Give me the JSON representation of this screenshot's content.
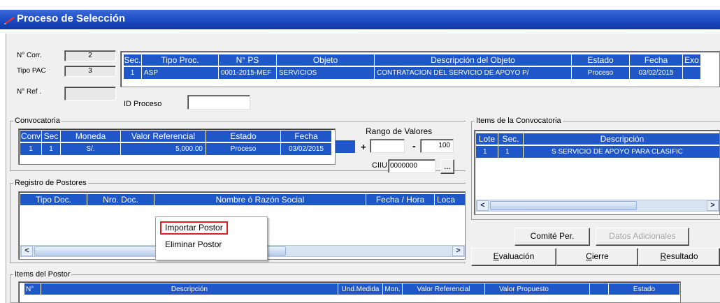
{
  "window": {
    "title": "Proceso de Selección"
  },
  "top": {
    "n_corr_label": "N° Corr.",
    "n_corr_value": "2",
    "tipo_pac_label": "Tipo PAC",
    "tipo_pac_value": "3",
    "n_ref_label": "N° Ref .",
    "n_ref_value": "",
    "id_proceso_label": "ID Proceso",
    "id_proceso_value": ""
  },
  "process_grid": {
    "headers": [
      "Sec.",
      "Tipo Proc.",
      "N° PS",
      "Objeto",
      "Descripción del Objeto",
      "Estado",
      "Fecha",
      "Exo"
    ],
    "row": [
      "1",
      "ASP",
      "0001-2015-MEF",
      "SERVICIOS",
      "CONTRATACION DEL SERVICIO DE APOYO P/",
      "Proceso",
      "03/02/2015",
      ""
    ]
  },
  "convocatoria": {
    "legend": "Convocatoria",
    "headers": [
      "Conv",
      "Sec",
      "Moneda",
      "Valor Referencial",
      "Estado",
      "Fecha"
    ],
    "row": [
      "1",
      "1",
      "S/.",
      "5,000.00",
      "Proceso",
      "03/02/2015"
    ]
  },
  "rango": {
    "label": "Rango de Valores",
    "plus": "+",
    "from": "",
    "minus": "-",
    "to": "100",
    "ciiu_label": "CIIU",
    "ciiu_value": "0000000",
    "lookup_label": "..."
  },
  "items_conv": {
    "legend": "Items de la Convocatoria",
    "headers": [
      "Lote",
      "Sec.",
      "Descripción"
    ],
    "row": [
      "1",
      "1",
      "S  SERVICIO DE APOYO PARA CLASIFIC"
    ]
  },
  "postores": {
    "legend": "Registro de Postores",
    "headers": [
      "Tipo Doc.",
      "Nro. Doc.",
      "Nombre ó Razón Social",
      "Fecha / Hora",
      "Loca"
    ]
  },
  "context_menu": {
    "items": [
      "Importar Postor",
      "Eliminar Postor"
    ]
  },
  "buttons": {
    "comite": "Comité Per.",
    "datos": "Datos Adicionales",
    "evaluacion": "Evaluación",
    "cierre": "Cierre",
    "resultado": "Resultado"
  },
  "items_postor": {
    "legend": "Items del Postor",
    "headers": [
      "N°",
      "Descripción",
      "Und.Medida",
      "Mon.",
      "Valor Referencial",
      "Valor  Propuesto",
      "",
      "Estado"
    ]
  },
  "colors": {
    "header_blue": "#1f56c8",
    "title_blue": "#1f4fc8",
    "highlight_red": "#e02020"
  }
}
